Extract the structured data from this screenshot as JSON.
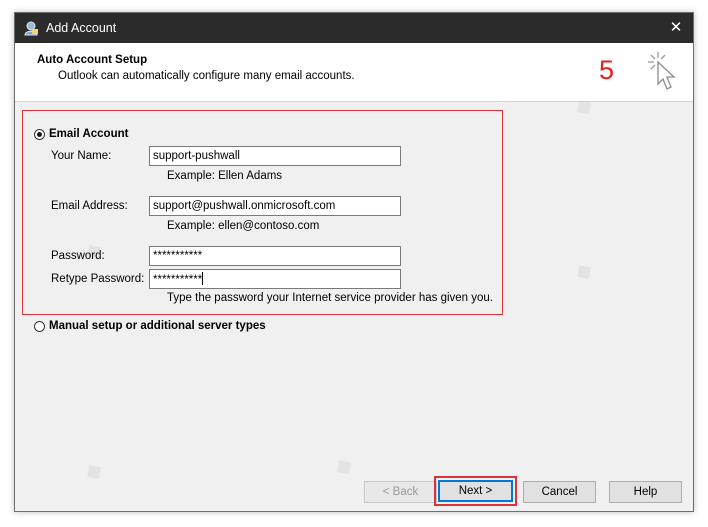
{
  "window": {
    "title": "Add Account",
    "close_glyph": "✕"
  },
  "header": {
    "title": "Auto Account Setup",
    "subtitle": "Outlook can automatically configure many email accounts.",
    "step_number": "5"
  },
  "options": {
    "email_account_label": "Email Account",
    "email_account_selected": true,
    "manual_setup_label": "Manual setup or additional server types",
    "manual_setup_selected": false
  },
  "form": {
    "name_label": "Your Name:",
    "name_value": "support-pushwall",
    "name_example": "Example: Ellen Adams",
    "email_label": "Email Address:",
    "email_value": "support@pushwall.onmicrosoft.com",
    "email_example": "Example: ellen@contoso.com",
    "password_label": "Password:",
    "password_value": "***********",
    "retype_label": "Retype Password:",
    "retype_value": "***********",
    "password_hint": "Type the password your Internet service provider has given you."
  },
  "buttons": {
    "back": "< Back",
    "next": "Next >",
    "cancel": "Cancel",
    "help": "Help"
  },
  "colors": {
    "titlebar": "#2b2b2b",
    "highlight_red": "#d9343b",
    "step_red": "#e8201a",
    "focus_blue": "#0078d7"
  }
}
